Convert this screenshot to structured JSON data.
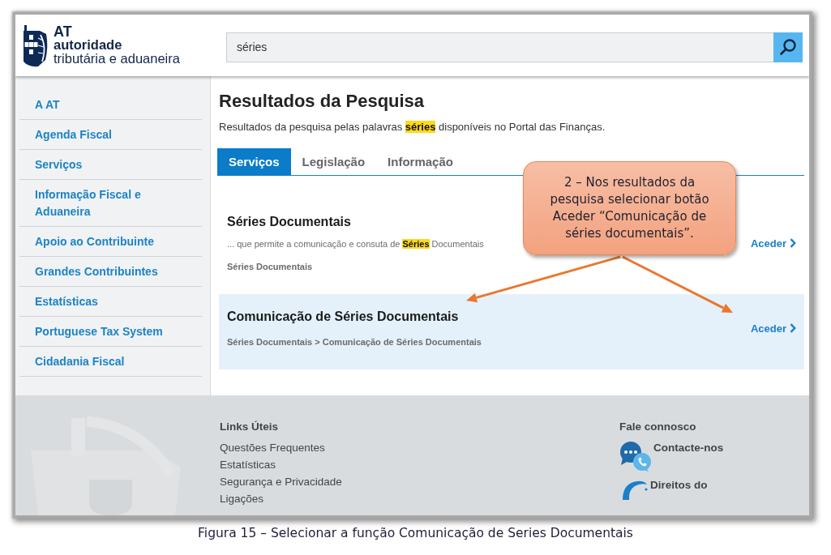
{
  "header": {
    "logo": {
      "acronym": "AT",
      "line_1": "autoridade",
      "line_2": "tributária e aduaneira"
    },
    "search": {
      "value": "séries"
    }
  },
  "sidebar": {
    "items": [
      {
        "label": "A AT"
      },
      {
        "label": "Agenda Fiscal"
      },
      {
        "label": "Serviços"
      },
      {
        "label": "Informação Fiscal e Aduaneira"
      },
      {
        "label": "Apoio ao Contribuinte"
      },
      {
        "label": "Grandes Contribuintes"
      },
      {
        "label": "Estatísticas"
      },
      {
        "label": "Portuguese Tax System"
      },
      {
        "label": "Cidadania Fiscal"
      }
    ]
  },
  "results": {
    "title": "Resultados da Pesquisa",
    "summary": "Resultados da pesquisa pelas palavras **séries** disponíveis no Portal das Finanças.",
    "tabs": [
      {
        "label": "Serviços",
        "selected": true
      },
      {
        "label": "Legislação",
        "selected": false
      },
      {
        "label": "Informação",
        "selected": false
      }
    ],
    "items": [
      {
        "title": "Séries Documentais",
        "snippet": "... que permite a comunicação e consuta de **Séries** Documentais",
        "path": "Séries Documentais",
        "action": "Aceder",
        "highlighted": false
      },
      {
        "title": "Comunicação de Séries Documentais",
        "path": "Séries Documentais > Comunicação de Séries Documentais",
        "action": "Aceder",
        "highlighted": true
      }
    ]
  },
  "footer": {
    "links_title": "Links Úteis",
    "links": [
      "Questões Frequentes",
      "Estatísticas",
      "Segurança e Privacidade",
      "Ligações"
    ],
    "contact_title": "Fale connosco",
    "contacts": [
      {
        "label": "Contacte-nos",
        "kind": "chat"
      },
      {
        "label": "Direitos do",
        "kind": "rights"
      }
    ]
  },
  "annotation": {
    "text": "2 – Nos resultados da pesquisa selecionar botão Aceder “Comunicação de séries documentais”."
  },
  "caption": "Figura 15 – Selecionar a função Comunicação de Series Documentais"
}
